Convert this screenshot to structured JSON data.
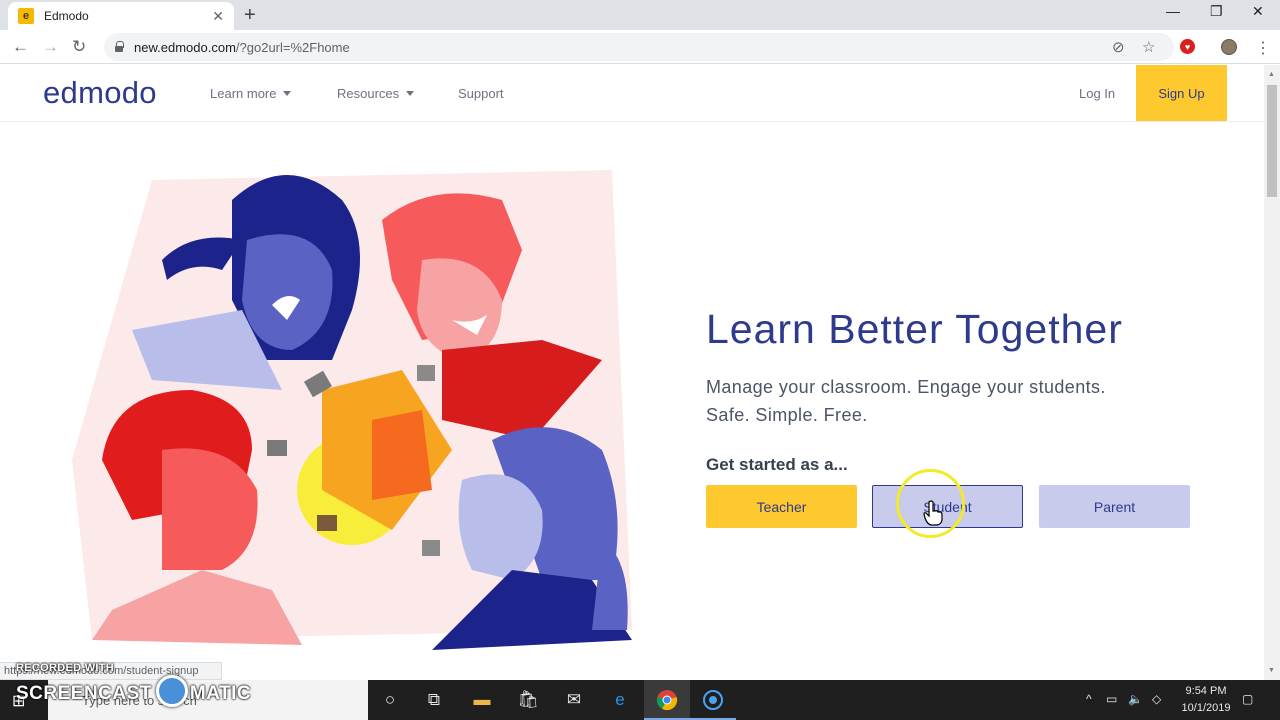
{
  "browser": {
    "tab_title": "Edmodo",
    "tab_favicon": "e",
    "url_host": "new.edmodo.com",
    "url_path": "/?go2url=%2Fhome",
    "status_url": "https://new.edmodo.com/student-signup"
  },
  "site": {
    "logo": "edmodo",
    "nav": {
      "learn_more": "Learn more",
      "resources": "Resources",
      "support": "Support",
      "log_in": "Log In",
      "sign_up": "Sign Up"
    },
    "hero": {
      "headline": "Learn Better Together",
      "subline_1": "Manage your classroom. Engage your students.",
      "subline_2": "Safe. Simple. Free.",
      "get_started": "Get started as a...",
      "roles": {
        "teacher": "Teacher",
        "student": "Student",
        "parent": "Parent"
      }
    }
  },
  "taskbar": {
    "search_placeholder": "Type here to search",
    "time": "9:54 PM",
    "date": "10/1/2019"
  },
  "watermark": {
    "line1": "RECORDED WITH",
    "word1": "SCREENCAST",
    "word2": "MATIC"
  },
  "colors": {
    "brand_navy": "#2e3a8c",
    "brand_yellow": "#fdc92f",
    "lavender": "#c8cbec"
  }
}
